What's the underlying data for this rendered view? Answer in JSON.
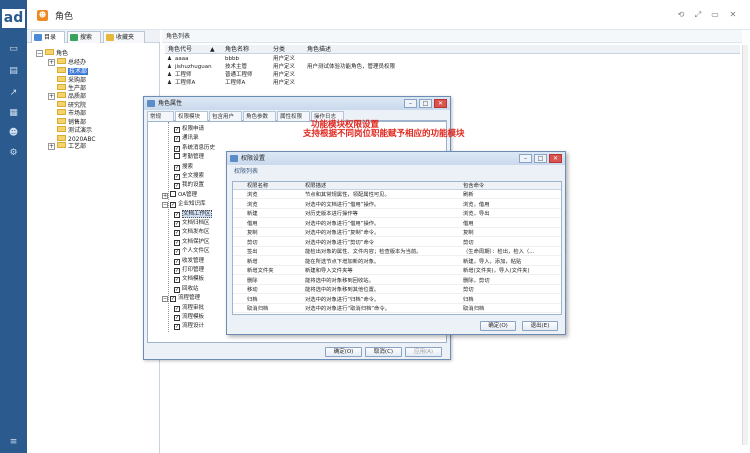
{
  "app": {
    "logo": "ad",
    "title": "角色"
  },
  "rail_icons": [
    "monitor-icon",
    "book-icon",
    "chart-icon",
    "document-icon",
    "users-icon",
    "gear-icon",
    "menu-icon"
  ],
  "window_buttons": [
    "⟲",
    "⤢",
    "▭",
    "✕"
  ],
  "left_tabs": [
    {
      "label": "目录"
    },
    {
      "label": "搜索"
    },
    {
      "label": "收藏夹"
    }
  ],
  "tree": {
    "root": "角色",
    "items": [
      {
        "label": "总经办",
        "level": 1,
        "expand": "+"
      },
      {
        "label": "技术部",
        "level": 1,
        "expand": "",
        "selected": true
      },
      {
        "label": "采购部",
        "level": 1,
        "expand": ""
      },
      {
        "label": "生产部",
        "level": 1,
        "expand": ""
      },
      {
        "label": "品质部",
        "level": 1,
        "expand": "+"
      },
      {
        "label": "研究院",
        "level": 1,
        "expand": ""
      },
      {
        "label": "市场部",
        "level": 1,
        "expand": ""
      },
      {
        "label": "销售部",
        "level": 1,
        "expand": ""
      },
      {
        "label": "测试演示",
        "level": 1,
        "expand": ""
      },
      {
        "label": "2020ABC",
        "level": 1,
        "expand": ""
      },
      {
        "label": "工艺部",
        "level": 1,
        "expand": "+"
      }
    ]
  },
  "role_list": {
    "header": "角色列表",
    "columns": [
      "角色代号",
      "角色名称",
      "分类",
      "角色描述"
    ],
    "rows": [
      [
        "aaaa",
        "bbbb",
        "用户定义",
        ""
      ],
      [
        "jishuzhuguan",
        "技术主管",
        "用户定义",
        "用户测试体验功能角色，管理员权限"
      ],
      [
        "工程师",
        "普通工程师",
        "用户定义",
        ""
      ],
      [
        "工程师A",
        "工程师A",
        "用户定义",
        ""
      ]
    ]
  },
  "dialog_role_props": {
    "title": "角色属性",
    "tabs": [
      "常规",
      "权限模块",
      "包含用户",
      "角色参数",
      "属性权限",
      "操作日志"
    ],
    "active_tab": 1,
    "nodes": [
      {
        "label": "权限申请",
        "checked": true,
        "level": 2
      },
      {
        "label": "通讯录",
        "checked": true,
        "level": 2
      },
      {
        "label": "系统消息历史",
        "checked": true,
        "level": 2
      },
      {
        "label": "考勤管理",
        "checked": false,
        "level": 2
      },
      {
        "label": "搜索",
        "checked": true,
        "level": 2
      },
      {
        "label": "全文搜索",
        "checked": true,
        "level": 2
      },
      {
        "label": "我的设置",
        "checked": true,
        "level": 2
      },
      {
        "label": "OA管理",
        "checked": false,
        "level": 1,
        "expand": "+"
      },
      {
        "label": "企业知识库",
        "checked": true,
        "level": 1,
        "expand": "−"
      },
      {
        "label": "文档工作区",
        "checked": true,
        "level": 2,
        "highlight": true
      },
      {
        "label": "文档归档区",
        "checked": true,
        "level": 2
      },
      {
        "label": "文档发布区",
        "checked": true,
        "level": 2
      },
      {
        "label": "文档保护区",
        "checked": true,
        "level": 2
      },
      {
        "label": "个人文件区",
        "checked": true,
        "level": 2
      },
      {
        "label": "收发管理",
        "checked": true,
        "level": 2
      },
      {
        "label": "打印管理",
        "checked": true,
        "level": 2
      },
      {
        "label": "文档模板",
        "checked": true,
        "level": 2
      },
      {
        "label": "回收站",
        "checked": true,
        "level": 2
      },
      {
        "label": "流程管理",
        "checked": true,
        "level": 1,
        "expand": "−"
      },
      {
        "label": "流程审批",
        "checked": true,
        "level": 2
      },
      {
        "label": "流程模板",
        "checked": true,
        "level": 2
      },
      {
        "label": "流程设计",
        "checked": true,
        "level": 2
      }
    ],
    "buttons": {
      "ok": "确定(O)",
      "cancel": "取消(C)",
      "apply": "应用(A)"
    }
  },
  "annotation": {
    "line1": "功能模块权限设置",
    "line2": "支持根据不同岗位职能赋予相应的功能模块"
  },
  "dialog_permissions": {
    "title": "权限设置",
    "subtitle": "权限列表",
    "columns": [
      "权限名称",
      "权限描述",
      "包含命令"
    ],
    "rows": [
      [
        "浏览",
        "节点和其常规属性，领配属性可见。",
        "刷新"
      ],
      [
        "浏览",
        "对选中的文档进行“借用”操作。",
        "浏览，借用"
      ],
      [
        "新建",
        "对历史版本进行操作等",
        "浏览，导出"
      ],
      [
        "借用",
        "对选中的对象进行“借用”操作。",
        "借用"
      ],
      [
        "复制",
        "对选中的对象进行“复制”命令。",
        "复制"
      ],
      [
        "剪切",
        "对选中的对象进行“剪切”命令",
        "剪切"
      ],
      [
        "签出",
        "能检出对象的属性、文件内容；检查版本为当前。",
        "（生命周期）：检出，检入（..."
      ],
      [
        "新增",
        "能在所选节点下增加新的对象。",
        "新建，导入，添加，粘贴"
      ],
      [
        "新增文件夹",
        "新建和导入文件夹等",
        "新增(文件夹)，导入(文件夹)"
      ],
      [
        "删除",
        "能将选中的对象移到回收站。",
        "删除，剪切"
      ],
      [
        "移动",
        "能将选中的对象移到其他位置。",
        "剪切"
      ],
      [
        "归档",
        "对选中的对象进行“归档”命令。",
        "归档"
      ],
      [
        "取消归档",
        "对选中的对象进行“取消归档”命令。",
        "取消归档"
      ]
    ],
    "buttons": {
      "ok": "确定(O)",
      "cancel": "退出(E)"
    }
  }
}
